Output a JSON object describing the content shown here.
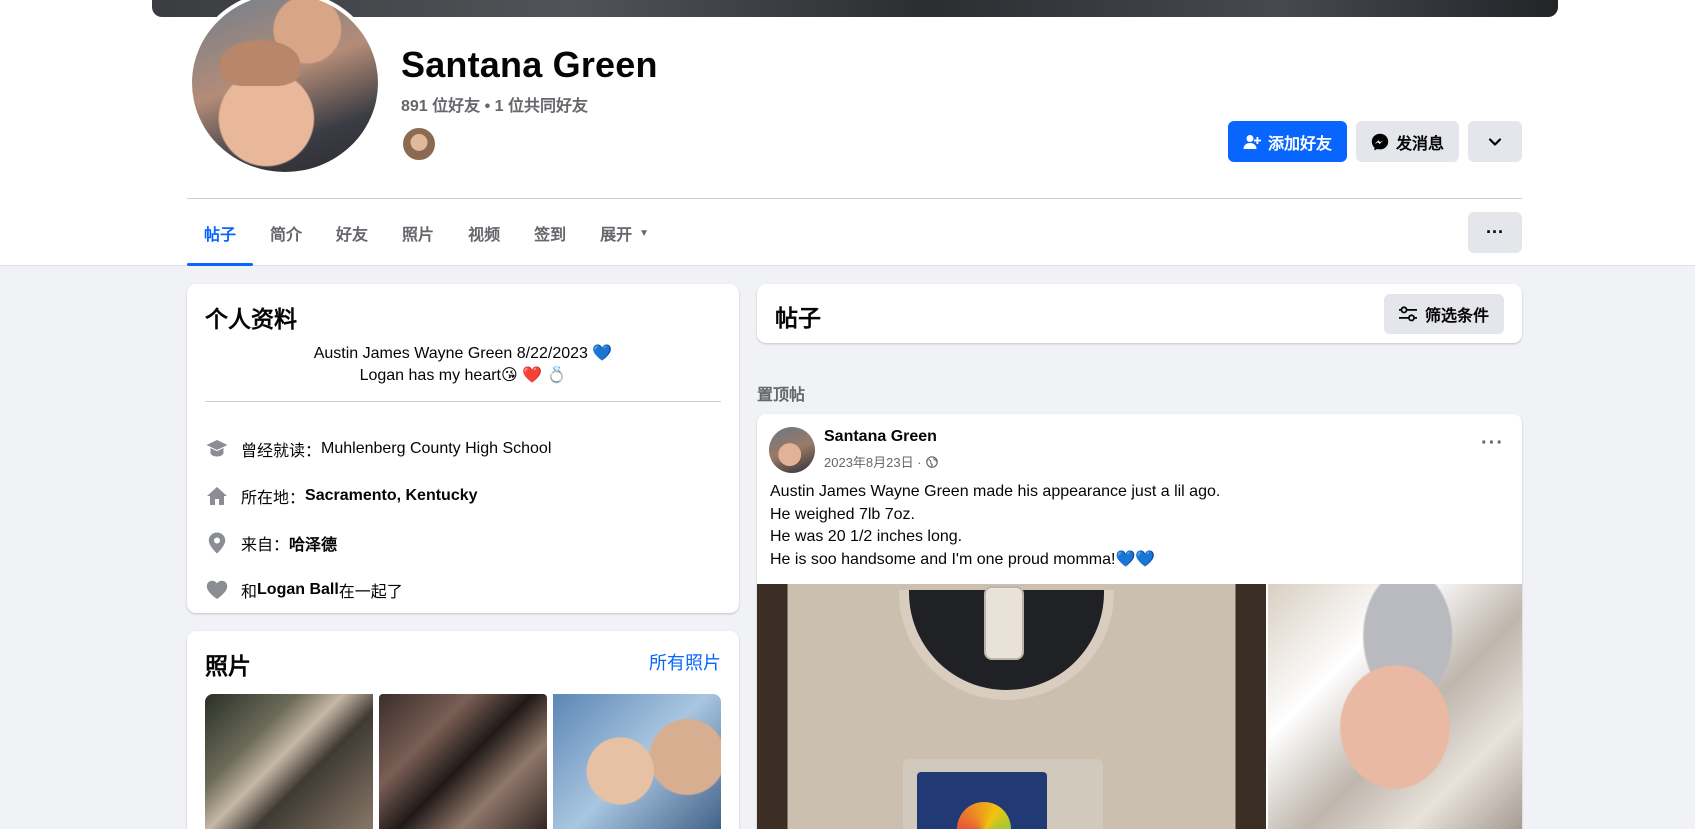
{
  "profile": {
    "name": "Santana Green",
    "friends_line": "891 位好友 • 1 位共同好友"
  },
  "actions": {
    "add_friend": "添加好友",
    "message": "发消息"
  },
  "tabs": [
    "帖子",
    "简介",
    "好友",
    "照片",
    "视频",
    "签到",
    "展开"
  ],
  "more_dots": "···",
  "intro": {
    "title": "个人资料",
    "bio_line1": "Austin James Wayne Green 8/22/2023 💙",
    "bio_line2": "Logan has my heart😘 ❤️ 💍",
    "school_prefix": "曾经就读：",
    "school": "Muhlenberg County High School",
    "location_prefix": "所在地：",
    "location": "Sacramento, Kentucky",
    "from_prefix": "来自：",
    "from": "哈泽德",
    "relationship_prefix": "和 ",
    "relationship_name": "Logan Ball",
    "relationship_suffix": " 在一起了"
  },
  "photos": {
    "title": "照片",
    "all_link": "所有照片"
  },
  "posts": {
    "title": "帖子",
    "filter": "筛选条件",
    "pinned_label": "置顶帖"
  },
  "post": {
    "author": "Santana Green",
    "date": "2023年8月23日 ·",
    "lines": [
      "Austin James Wayne Green made his appearance just a lil ago.",
      "He weighed 7lb 7oz.",
      "He was 20 1/2 inches long.",
      "He is soo handsome and I'm one proud momma!💙💙"
    ]
  },
  "icons": {
    "add_friend": "person-plus-icon",
    "message": "messenger-icon",
    "dropdown": "chevron-down-icon",
    "school": "graduation-cap-icon",
    "home": "home-icon",
    "location": "map-pin-icon",
    "relationship": "heart-icon",
    "filter": "sliders-icon",
    "audience": "globe-icon"
  },
  "colors": {
    "accent": "#0866ff",
    "secondary_text": "#65676b",
    "button_gray": "#e4e6eb",
    "page_bg": "#f0f2f5"
  }
}
